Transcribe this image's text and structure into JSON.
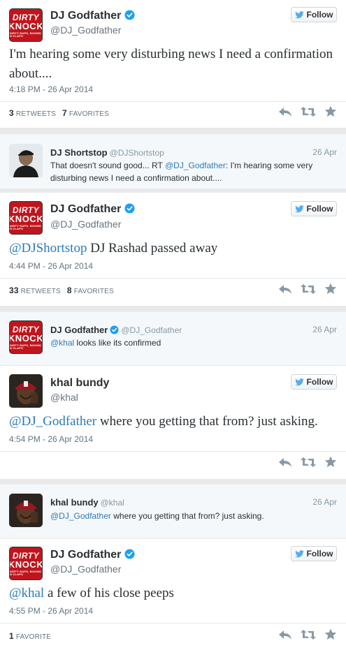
{
  "follow_label": "Follow",
  "tweets": [
    {
      "name": "DJ Godfather",
      "handle": "@DJ_Godfather",
      "text": "I'm hearing some very disturbing news I need a confirmation about....",
      "timestamp": "4:18 PM - 26 Apr 2014",
      "retweets": "3",
      "retweets_label": "Retweets",
      "favorites": "7",
      "favorites_label": "Favorites"
    },
    {
      "name": "DJ Godfather",
      "handle": "@DJ_Godfather",
      "mention": "@DJShortstop",
      "text": " DJ Rashad passed away",
      "timestamp": "4:44 PM - 26 Apr 2014",
      "retweets": "33",
      "retweets_label": "Retweets",
      "favorites": "8",
      "favorites_label": "Favorites"
    },
    {
      "name": "khal bundy",
      "handle": "@khal",
      "mention": "@DJ_Godfather",
      "text": " where you getting that from? just asking.",
      "timestamp": "4:54 PM - 26 Apr 2014"
    },
    {
      "name": "DJ Godfather",
      "handle": "@DJ_Godfather",
      "mention": "@khal",
      "text": " a few of his close peeps",
      "timestamp": "4:55 PM - 26 Apr 2014",
      "favorites": "1",
      "favorites_label": "Favorite"
    }
  ],
  "replies": [
    {
      "name": "DJ Shortstop",
      "handle": "@DJShortstop",
      "date": "26 Apr",
      "text_a": "That doesn't sound good... RT ",
      "mention": "@DJ_Godfather",
      "text_b": ": I'm hearing some very disturbing news I need a confirmation about...."
    },
    {
      "name": "DJ Godfather",
      "handle": "@DJ_Godfather",
      "date": "26 Apr",
      "mention": "@khal",
      "text_b": " looks like its confirmed"
    },
    {
      "name": "khal bundy",
      "handle": "@khal",
      "date": "26 Apr",
      "mention": "@DJ_Godfather",
      "text_b": " where you getting that from? just asking."
    }
  ],
  "logo": {
    "line1": "DIRTY",
    "line2": "KNOCK",
    "line3": "DIRTY RAPS, BOOMS N CLAPS"
  },
  "colors": {
    "link": "#2b7bb9",
    "verified": "#1da1f2",
    "logo_red": "#c0151d"
  }
}
